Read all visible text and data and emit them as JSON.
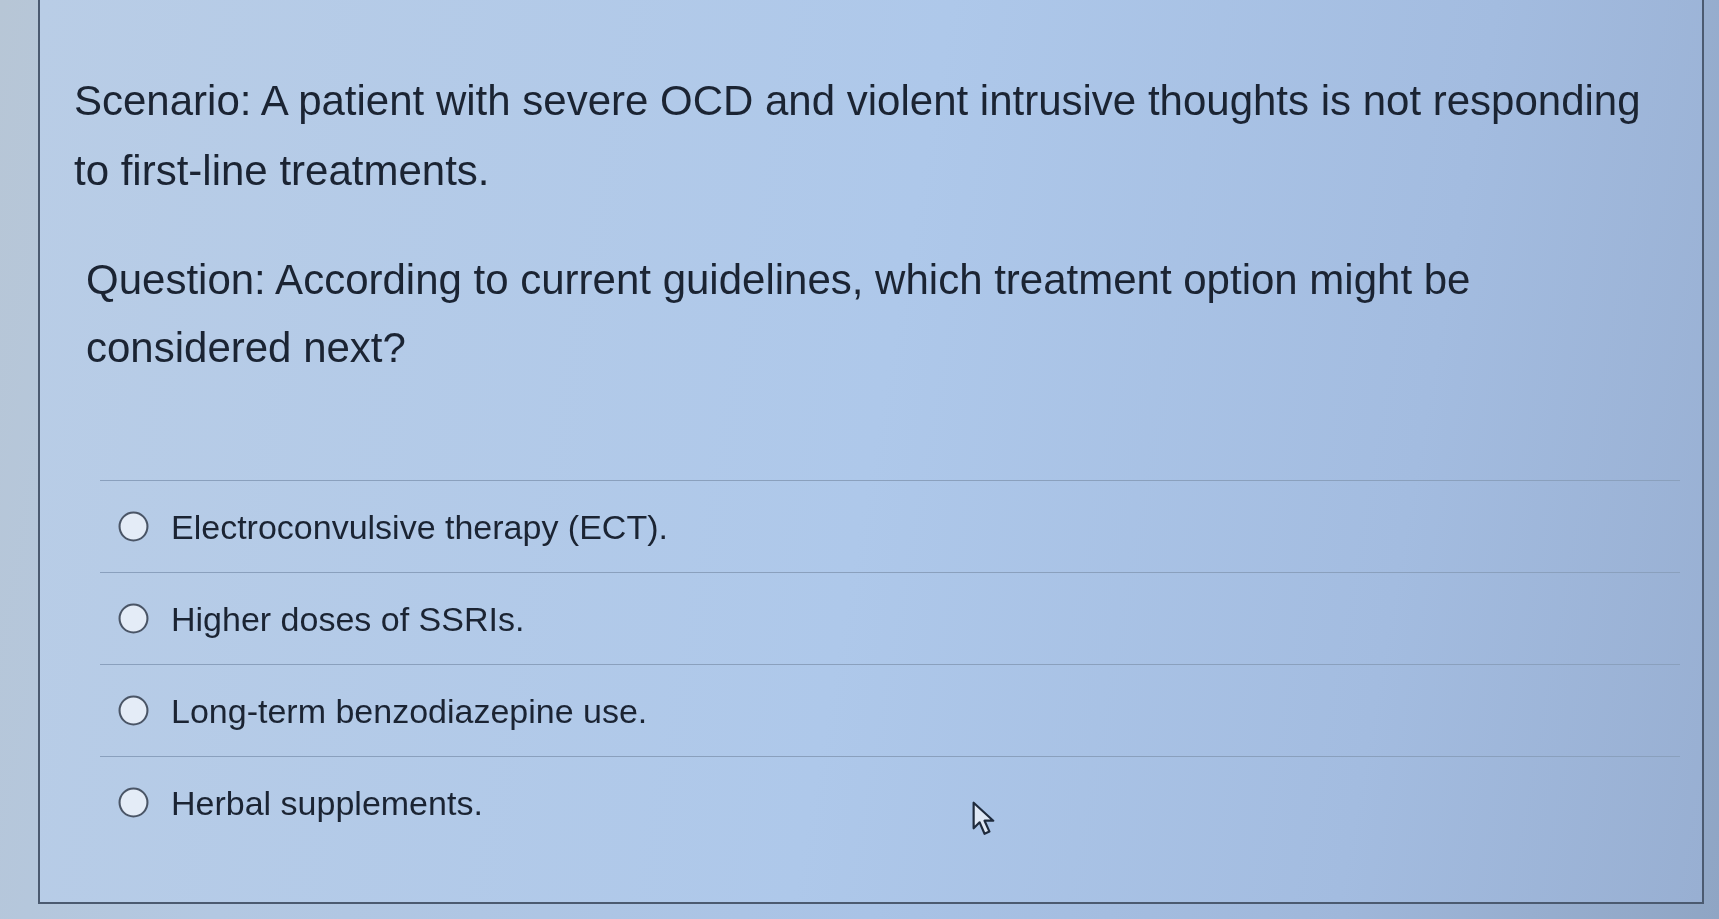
{
  "scenario": "Scenario: A patient with severe OCD and violent intrusive thoughts is not responding to first-line treatments.",
  "question": "Question: According to current guidelines, which treatment option might be considered next?",
  "options": [
    {
      "label": "Electroconvulsive therapy (ECT).",
      "selected": false
    },
    {
      "label": "Higher doses of SSRIs.",
      "selected": false
    },
    {
      "label": "Long-term benzodiazepine use.",
      "selected": false
    },
    {
      "label": "Herbal supplements.",
      "selected": false
    }
  ]
}
